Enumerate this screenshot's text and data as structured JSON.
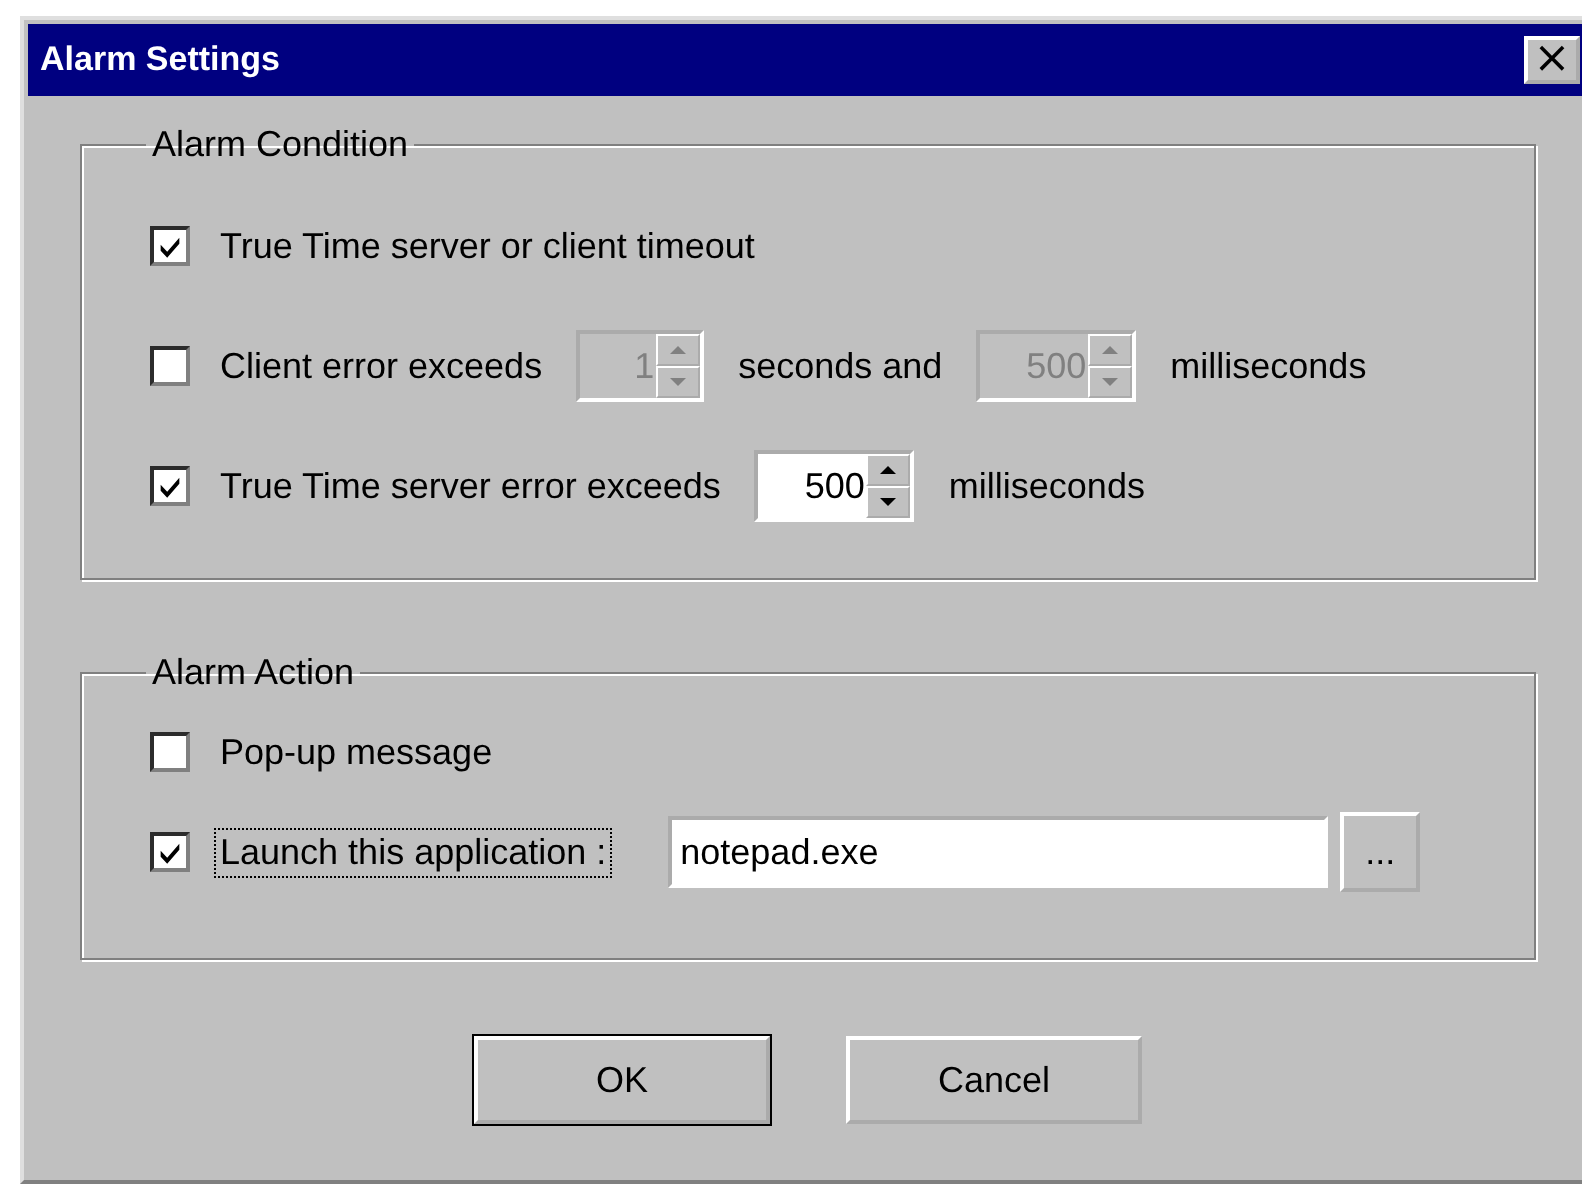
{
  "window": {
    "title": "Alarm Settings",
    "close": "×"
  },
  "condition_group": {
    "title": "Alarm Condition",
    "rows": [
      {
        "checked": true,
        "parts": [
          {
            "kind": "text",
            "text": "True Time server or client timeout"
          }
        ]
      },
      {
        "checked": false,
        "parts": [
          {
            "kind": "text",
            "text": "Client error exceeds"
          },
          {
            "kind": "spin",
            "value": "1",
            "disabled": true
          },
          {
            "kind": "text",
            "text": "seconds and"
          },
          {
            "kind": "spin",
            "value": "500",
            "disabled": true
          },
          {
            "kind": "text",
            "text": "milliseconds"
          }
        ]
      },
      {
        "checked": true,
        "parts": [
          {
            "kind": "text",
            "text": "True Time server error exceeds"
          },
          {
            "kind": "spin",
            "value": "500",
            "disabled": false
          },
          {
            "kind": "text",
            "text": "milliseconds"
          }
        ]
      }
    ]
  },
  "action_group": {
    "title": "Alarm Action",
    "rows": [
      {
        "kind": "check",
        "label": "Pop-up message",
        "checked": false,
        "focused": false
      },
      {
        "kind": "app",
        "label": "Launch this application :",
        "checked": true,
        "focused": true,
        "value": "notepad.exe",
        "browse": "..."
      }
    ]
  },
  "buttons": [
    {
      "label": "OK",
      "default": true
    },
    {
      "label": "Cancel",
      "default": false
    }
  ]
}
